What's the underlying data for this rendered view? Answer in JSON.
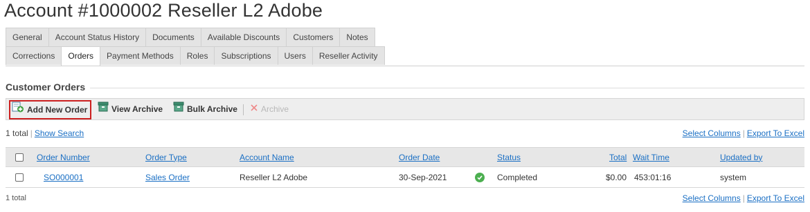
{
  "page": {
    "title": "Account #1000002 Reseller L2 Adobe"
  },
  "tabs": {
    "row1": [
      "General",
      "Account Status History",
      "Documents",
      "Available Discounts",
      "Customers",
      "Notes"
    ],
    "row2": [
      "Corrections",
      "Orders",
      "Payment Methods",
      "Roles",
      "Subscriptions",
      "Users",
      "Reseller Activity"
    ],
    "active": "Orders"
  },
  "section": {
    "title": "Customer Orders"
  },
  "toolbar": {
    "add_new_order": "Add New Order",
    "view_archive": "View Archive",
    "bulk_archive": "Bulk Archive",
    "archive": "Archive",
    "icons": [
      "add-document-icon",
      "archive-box-icon",
      "archive-box-icon",
      "x-icon"
    ]
  },
  "summary": {
    "total_top": "1 total",
    "show_search": "Show Search",
    "select_columns": "Select Columns",
    "export_to_excel": "Export To Excel",
    "separator": "|",
    "total_bottom": "1 total"
  },
  "grid": {
    "columns": {
      "order_number": "Order Number",
      "order_type": "Order Type",
      "account_name": "Account Name",
      "order_date": "Order Date",
      "status": "Status",
      "total": "Total",
      "wait_time": "Wait Time",
      "updated_by": "Updated by"
    },
    "rows": [
      {
        "order_number": "SO000001",
        "order_type": "Sales Order",
        "account_name": "Reseller L2 Adobe",
        "order_date": "30-Sep-2021",
        "status_icon": "check-circle-icon",
        "status": "Completed",
        "total": "$0.00",
        "wait_time": "453:01:16",
        "updated_by": "system"
      }
    ]
  },
  "colors": {
    "link": "#1a6fc4",
    "highlight_border": "#cc1f1f",
    "status_ok": "#4caf50",
    "tab_bg": "#e4e4e4",
    "header_bg": "#e7e7e7"
  }
}
